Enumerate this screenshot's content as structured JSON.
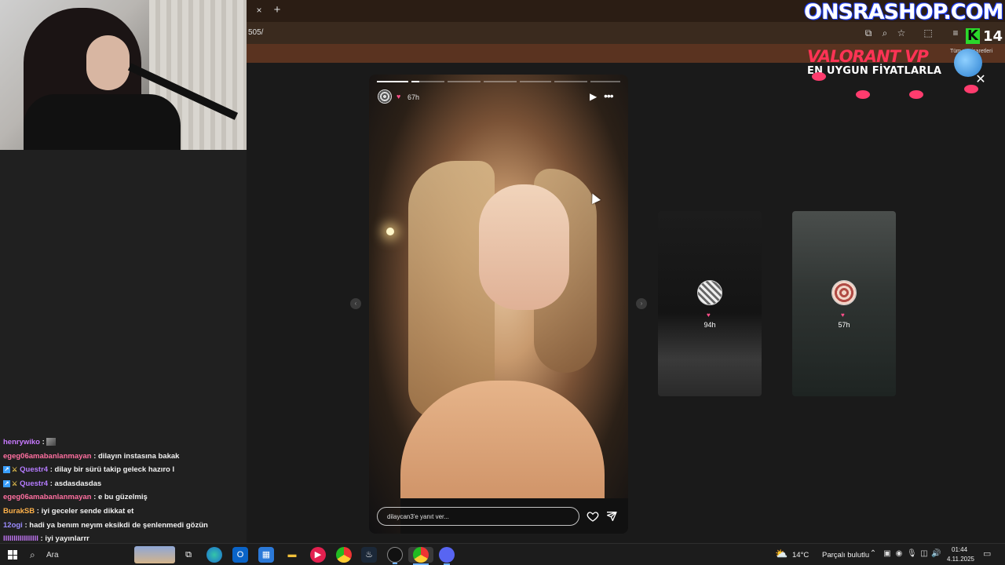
{
  "browser": {
    "tab_close": "×",
    "new_tab": "+",
    "url": "505/",
    "toolbar_icons": [
      "install-icon",
      "zoom-icon",
      "star-icon",
      "extensions-icon",
      "reading-list-icon"
    ]
  },
  "story": {
    "time_ago": "67h",
    "progress_segments": 7,
    "active_segment": 1,
    "reply_placeholder": "dilaycan3'e yanıt ver...",
    "prev_arrow": "‹",
    "next_arrow": "›"
  },
  "previews": [
    {
      "time_ago": "94h"
    },
    {
      "time_ago": "57h"
    }
  ],
  "ad": {
    "logo": "ONSRASHOP.COM",
    "k_logo": "K",
    "count": "14",
    "headline": "VALORANT VP",
    "subline": "EN UYGUN FİYATLARLA",
    "tiny_text": "Tüm yer işaretleri",
    "close": "✕"
  },
  "chat": [
    {
      "user": "henrywiko",
      "user_color": "#c879ff",
      "badges": [],
      "message": "",
      "emote": true
    },
    {
      "user": "egeg06amabanlanmayan",
      "user_color": "#ff6fa0",
      "badges": [],
      "message": "dilayın instasına bakak"
    },
    {
      "user": "Questr4",
      "user_color": "#b57bff",
      "badges": [
        "badge",
        "sword"
      ],
      "message": "dilay bir sürü takip geleck hazıro l"
    },
    {
      "user": "Questr4",
      "user_color": "#b57bff",
      "badges": [
        "badge",
        "sword"
      ],
      "message": "asdasdasdas"
    },
    {
      "user": "egeg06amabanlanmayan",
      "user_color": "#ff6fa0",
      "badges": [],
      "message": "e bu güzelmiş"
    },
    {
      "user": "BurakSB",
      "user_color": "#ffb24a",
      "badges": [],
      "message": "iyi geceler sende dikkat et"
    },
    {
      "user": "12ogi",
      "user_color": "#9b8cff",
      "badges": [],
      "message": "hadi ya benım neyım eksikdi de şenlenmedi gözün"
    },
    {
      "user": "lllllllllllllllll",
      "user_color": "#c879ff",
      "badges": [],
      "message": "iyi yayınlarrr"
    }
  ],
  "taskbar": {
    "search_label": "Ara",
    "weather_temp": "14°C",
    "weather_desc": "Parçalı bulutlu",
    "time": "01:44",
    "date": "4.11.2025"
  }
}
